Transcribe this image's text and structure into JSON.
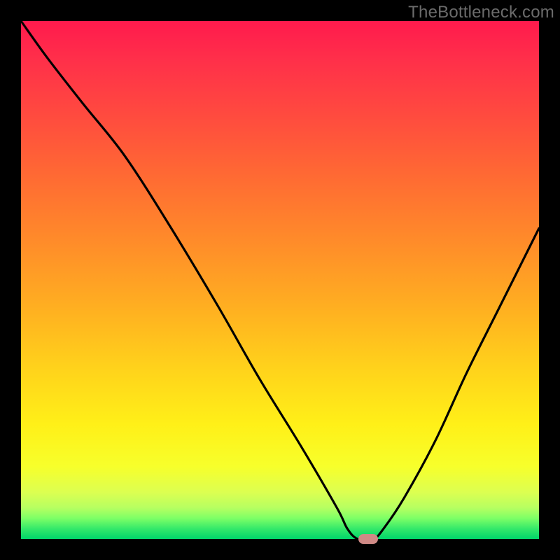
{
  "watermark": "TheBottleneck.com",
  "colors": {
    "page_bg": "#000000",
    "gradient_top": "#ff1a4d",
    "gradient_mid": "#ffd21b",
    "gradient_bottom": "#00d56a",
    "curve": "#000000",
    "marker": "#d08a86"
  },
  "chart_data": {
    "type": "line",
    "title": "",
    "xlabel": "",
    "ylabel": "",
    "xlim": [
      0,
      100
    ],
    "ylim": [
      0,
      100
    ],
    "series": [
      {
        "name": "bottleneck-curve",
        "x": [
          0,
          5,
          12,
          20,
          29,
          38,
          46,
          54,
          61,
          63,
          65,
          68,
          70,
          74,
          80,
          86,
          92,
          100
        ],
        "values": [
          100,
          93,
          84,
          74,
          60,
          45,
          31,
          18,
          6,
          2,
          0,
          0,
          2,
          8,
          19,
          32,
          44,
          60
        ]
      }
    ],
    "annotations": [
      {
        "name": "min-marker",
        "x": 67,
        "y": 0
      }
    ],
    "grid": false,
    "legend": false
  }
}
